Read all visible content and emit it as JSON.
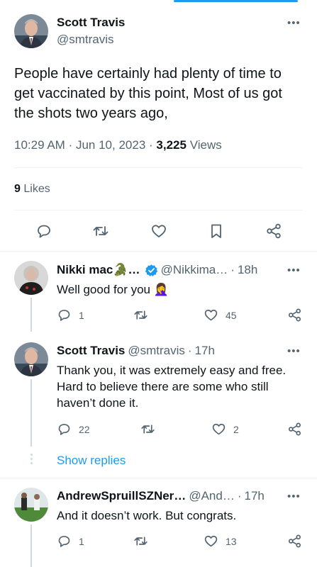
{
  "main": {
    "author_name": "Scott Travis",
    "author_handle": "@smtravis",
    "text": "People have certainly had plenty of time to get vaccinated by this point, Most of us got the shots two years ago,",
    "time": "10:29 AM",
    "date": "Jun 10, 2023",
    "views_count": "3,225",
    "views_label": "Views",
    "likes_count": "9",
    "likes_label": "Likes"
  },
  "replies": [
    {
      "name": "Nikki mac🐊…",
      "handle": "@Nikkima…",
      "age": "18h",
      "text": "Well good for you 🤦‍♀️",
      "replies": "1",
      "likes": "45"
    },
    {
      "name": "Scott Travis",
      "handle": "@smtravis",
      "age": "17h",
      "text": "Thank you, it was extremely easy and free. Hard to believe there are some who still haven’t done it.",
      "replies": "22",
      "likes": "2"
    },
    {
      "name": "AndrewSpruillSZNer…",
      "handle": "@And…",
      "age": "17h",
      "text": "And it doesn’t work. But congrats.",
      "replies": "1",
      "likes": "13"
    }
  ],
  "show_replies": "Show replies",
  "separator": "·",
  "colors": {
    "accent": "#1d9bf0",
    "muted": "#536471",
    "text": "#0f1419",
    "verified": "#1d9bf0"
  },
  "icons": [
    "more-icon",
    "reply-icon",
    "retweet-icon",
    "like-icon",
    "bookmark-icon",
    "share-icon",
    "verified-icon"
  ]
}
